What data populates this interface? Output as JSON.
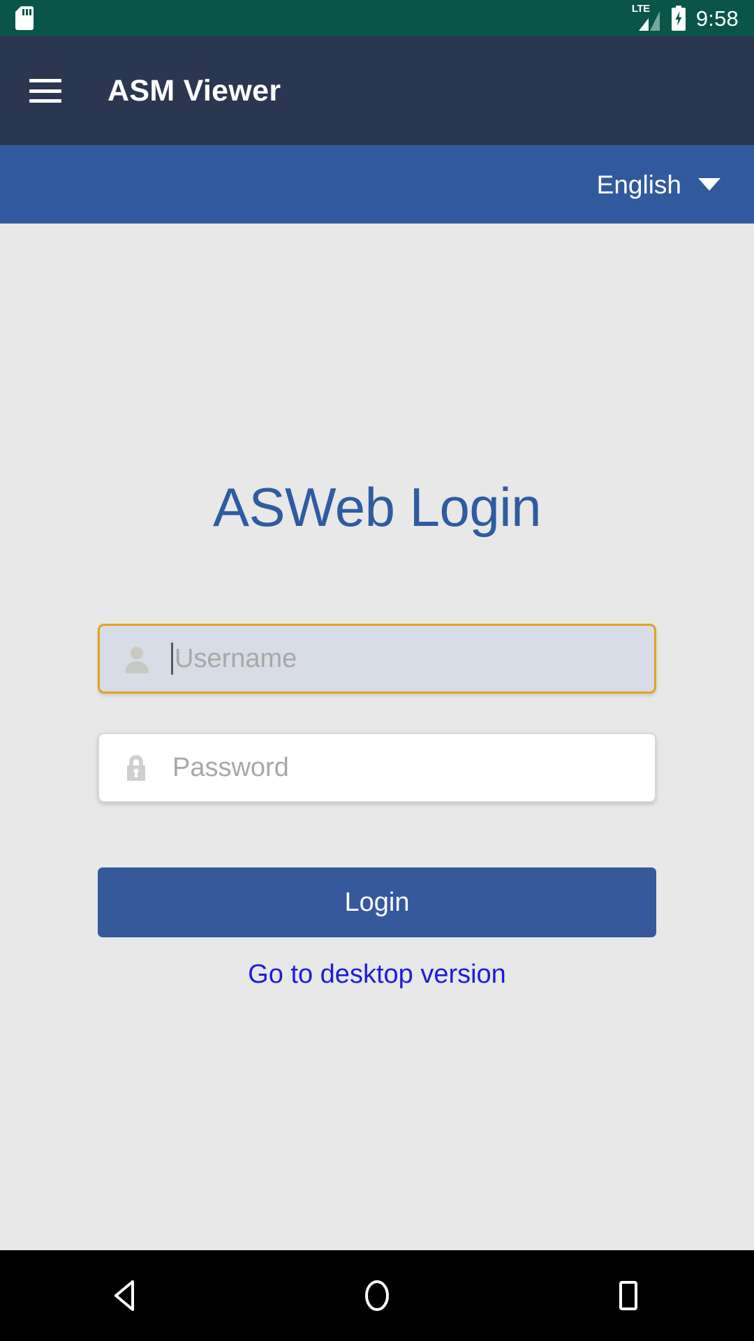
{
  "status_bar": {
    "background_color": "#0a5549",
    "sdcard_icon": "sd-card-icon",
    "network_label": "LTE",
    "signal_icon": "signal-bars-icon",
    "battery_icon": "battery-charging-icon",
    "time": "9:58"
  },
  "app_bar": {
    "background_color": "#2b3650",
    "menu_icon": "hamburger-menu-icon",
    "title": "ASM Viewer"
  },
  "language_bar": {
    "background_color": "#31599d",
    "selected_language": "English",
    "caret_icon": "chevron-down-icon"
  },
  "login_form": {
    "heading": "ASWeb Login",
    "heading_color": "#2e5ca0",
    "username": {
      "placeholder": "Username",
      "value": "",
      "icon": "user-icon",
      "focused": true,
      "focus_border_color": "#e5a11c",
      "background_color": "#d7dce6"
    },
    "password": {
      "placeholder": "Password",
      "value": "",
      "icon": "lock-icon",
      "focused": false,
      "border_color": "#d8d8d8",
      "background_color": "#ffffff"
    },
    "submit_label": "Login",
    "submit_color": "#35599b",
    "desktop_link_label": "Go to desktop version",
    "desktop_link_color": "#1c1ce0"
  },
  "nav_bar": {
    "background_color": "#000000",
    "back_icon": "back-triangle-icon",
    "home_icon": "home-circle-icon",
    "recents_icon": "recents-square-icon"
  }
}
